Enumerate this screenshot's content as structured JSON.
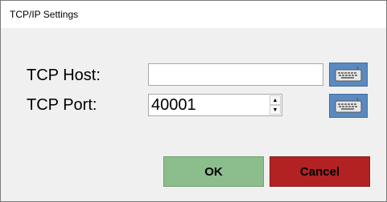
{
  "window": {
    "title": "TCP/IP Settings"
  },
  "form": {
    "host_label": "TCP Host:",
    "host_value": "",
    "port_label": "TCP Port:",
    "port_value": "40001",
    "keyboard_icon": "keyboard-icon",
    "spin_up_glyph": "▲",
    "spin_down_glyph": "▼"
  },
  "buttons": {
    "ok_label": "OK",
    "cancel_label": "Cancel"
  },
  "colors": {
    "ok_bg": "#8cbd8c",
    "cancel_bg": "#b22222",
    "keyboard_btn_bg": "#5a8ac0"
  }
}
